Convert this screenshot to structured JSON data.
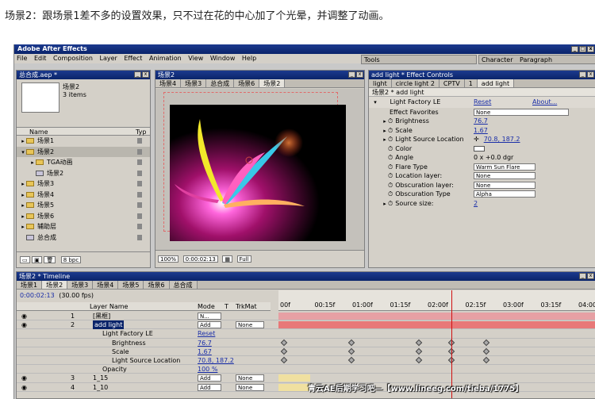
{
  "caption": "场景2：跟场景1差不多的设置效果，只不过在花的中心加了个光晕，并调整了动画。",
  "app": {
    "title": "Adobe After Effects",
    "menu": [
      "File",
      "Edit",
      "Composition",
      "Layer",
      "Effect",
      "Animation",
      "View",
      "Window",
      "Help"
    ]
  },
  "tools": {
    "label": "Tools"
  },
  "char_panel": {
    "tabs": [
      "Character",
      "Paragraph"
    ]
  },
  "project": {
    "title": "总合成.aep *",
    "selected_name": "场景2",
    "items_count": "3 items",
    "col_name": "Name",
    "col_type": "Typ",
    "items": [
      {
        "label": "场景1",
        "type": "folder",
        "expanded": false
      },
      {
        "label": "场景2",
        "type": "folder",
        "expanded": true
      },
      {
        "label": "TGA动画",
        "type": "folder",
        "expanded": false
      },
      {
        "label": "场景2",
        "type": "comp",
        "expanded": false
      },
      {
        "label": "场景3",
        "type": "folder",
        "expanded": false
      },
      {
        "label": "场景4",
        "type": "folder",
        "expanded": false
      },
      {
        "label": "场景5",
        "type": "folder",
        "expanded": false
      },
      {
        "label": "场景6",
        "type": "folder",
        "expanded": false
      },
      {
        "label": "辅助层",
        "type": "folder",
        "expanded": false
      },
      {
        "label": "总合成",
        "type": "comp",
        "expanded": false
      }
    ],
    "bpc": "8 bpc"
  },
  "comp": {
    "title": "场景2",
    "tabs": [
      "场景4",
      "场景3",
      "总合成",
      "场景6",
      "场景2"
    ],
    "zoom": "100%",
    "timecode": "0:00:02:13",
    "resolution": "Full"
  },
  "effect_controls": {
    "title": "add light * Effect Controls",
    "tabs": [
      "light",
      "circle light 2",
      "CPTV",
      "1",
      "add light"
    ],
    "header": "场景2 * add light",
    "effect_name": "Light Factory LE",
    "reset_label": "Reset",
    "about_label": "About...",
    "params": [
      {
        "label": "Effect Favorites",
        "value": "None",
        "kind": "dropdown"
      },
      {
        "label": "Brightness",
        "value": "76.7",
        "kind": "link"
      },
      {
        "label": "Scale",
        "value": "1.67",
        "kind": "link"
      },
      {
        "label": "Light Source Location",
        "value": "70.8, 187.2",
        "kind": "point"
      },
      {
        "label": "Color",
        "value": "",
        "kind": "color"
      },
      {
        "label": "Angle",
        "value": "0 x +0.0 dgr",
        "kind": "text"
      },
      {
        "label": "Flare Type",
        "value": "Warm Sun Flare",
        "kind": "dropdown"
      },
      {
        "label": "Location layer:",
        "value": "None",
        "kind": "dropdown"
      },
      {
        "label": "Obscuration layer:",
        "value": "None",
        "kind": "dropdown"
      },
      {
        "label": "Obscuration Type",
        "value": "Alpha",
        "kind": "dropdown"
      },
      {
        "label": "Source size:",
        "value": "2",
        "kind": "link"
      }
    ]
  },
  "timeline": {
    "title": "场景2 * Timeline",
    "tabs": [
      "场景1",
      "场景2",
      "场景3",
      "场景4",
      "场景5",
      "场景6",
      "总合成"
    ],
    "timecode": "0:00:02:13",
    "fps": "(30.00 fps)",
    "col_layer": "Layer Name",
    "col_mode": "Mode",
    "col_t": "T",
    "col_trkmat": "TrkMat",
    "ruler": [
      "00f",
      "00:15f",
      "01:00f",
      "01:15f",
      "02:00f",
      "02:15f",
      "03:00f",
      "03:15f",
      "04:00f"
    ],
    "current_time_fraction": 0.547,
    "rows": [
      {
        "num": "1",
        "name": "[黑框]",
        "mode": "N...",
        "trkmat": "",
        "indent": 0
      },
      {
        "num": "2",
        "name": "add light",
        "mode": "Add",
        "trkmat": "None",
        "indent": 0
      },
      {
        "num": "",
        "name": "Light Factory LE",
        "mode": "Reset",
        "trkmat": "",
        "indent": 1
      },
      {
        "num": "",
        "name": "Brightness",
        "mode": "76.7",
        "trkmat": "",
        "indent": 2
      },
      {
        "num": "",
        "name": "Scale",
        "mode": "1.67",
        "trkmat": "",
        "indent": 2
      },
      {
        "num": "",
        "name": "Light Source Location",
        "mode": "70.8, 187.2",
        "trkmat": "",
        "indent": 2
      },
      {
        "num": "",
        "name": "Opacity",
        "mode": "100 %",
        "trkmat": "",
        "indent": 1
      },
      {
        "num": "3",
        "name": "1_15",
        "mode": "Add",
        "trkmat": "None",
        "indent": 0
      },
      {
        "num": "4",
        "name": "1_10",
        "mode": "Add",
        "trkmat": "None",
        "indent": 0
      }
    ]
  },
  "watermark": "青云AE后期学习吧—【www.lineeg.com/tieba/1775】"
}
